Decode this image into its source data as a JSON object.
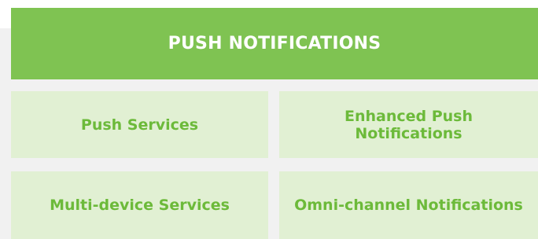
{
  "header": {
    "title": "PUSH NOTIFICATIONS"
  },
  "tiles": [
    {
      "label": "Push Services"
    },
    {
      "label": "Enhanced Push Notifications"
    },
    {
      "label": "Multi-device Services"
    },
    {
      "label": "Omni-channel Notifications"
    }
  ],
  "colors": {
    "header_bg": "#7fc352",
    "header_text": "#ffffff",
    "tile_bg": "#e1f0d3",
    "tile_text": "#6cba3a",
    "panel_bg": "#f1f1f1"
  }
}
